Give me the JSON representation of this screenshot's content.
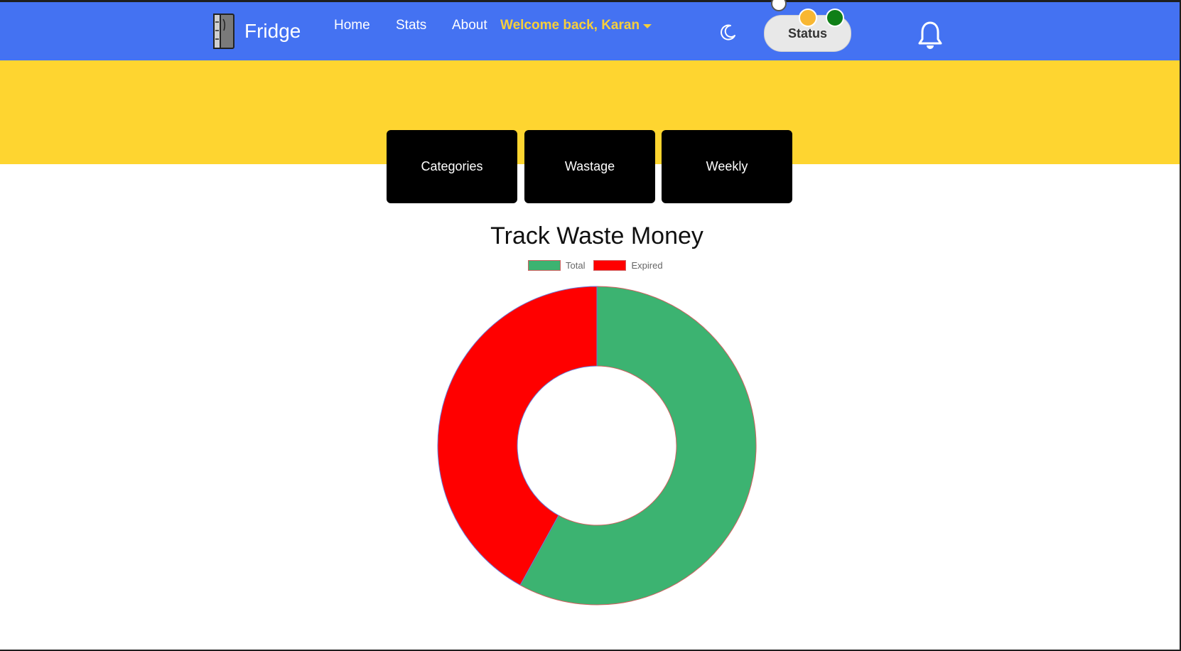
{
  "nav": {
    "brand": "Fridge",
    "links": [
      {
        "label": "Home"
      },
      {
        "label": "Stats"
      },
      {
        "label": "About"
      }
    ],
    "welcome": "Welcome back, Karan",
    "status_label": "Status",
    "icons": [
      "fridge-icon",
      "moon-icon",
      "bell-icon"
    ]
  },
  "tabs": [
    {
      "label": "Categories"
    },
    {
      "label": "Wastage"
    },
    {
      "label": "Weekly"
    }
  ],
  "colors": {
    "nav": "#4472f2",
    "banner": "#fed530",
    "welcome": "#f6cf3b",
    "total": "#3cb371",
    "expired": "#ff0000"
  },
  "chart_data": {
    "type": "pie",
    "title": "Track Waste Money",
    "labels": [
      "Total",
      "Expired"
    ],
    "values": [
      58,
      42
    ],
    "colors": [
      "#3cb371",
      "#ff0000"
    ],
    "cutout": "50%",
    "legend": "top"
  }
}
